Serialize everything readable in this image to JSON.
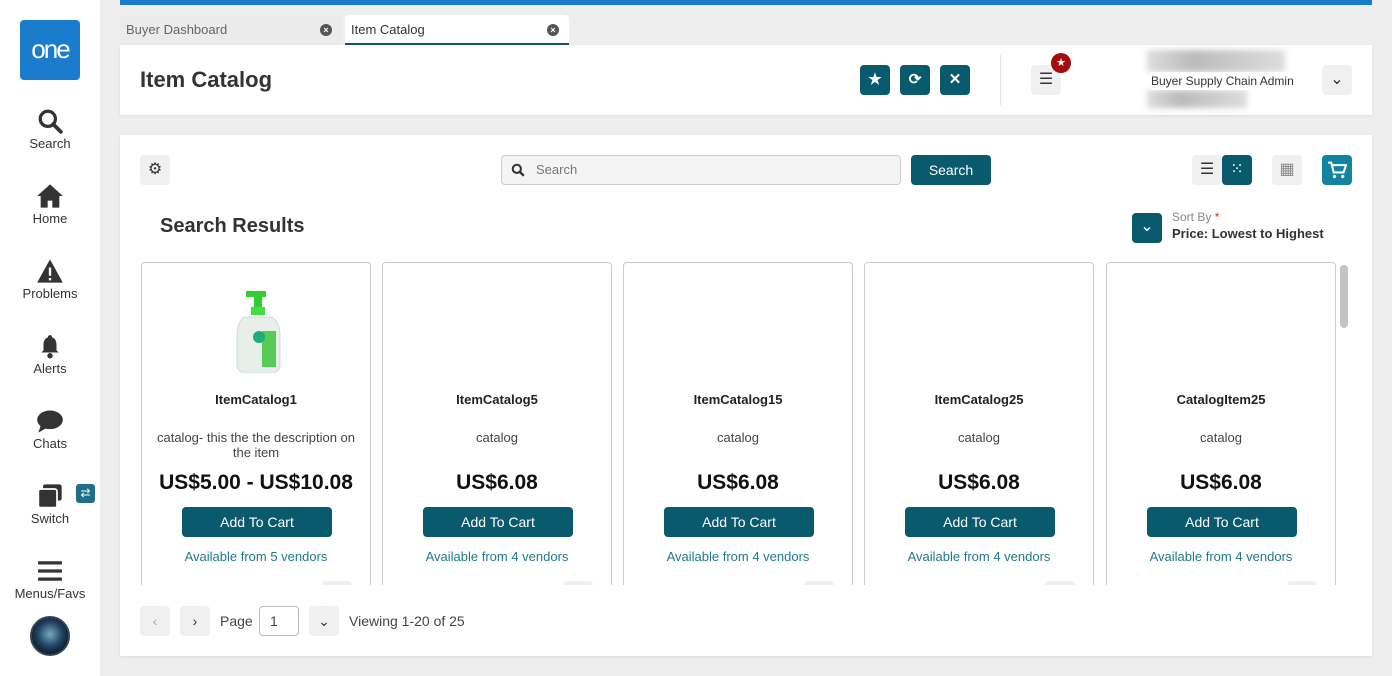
{
  "sidebar": {
    "logo": "one",
    "items": [
      {
        "label": "Search",
        "icon": "search-icon"
      },
      {
        "label": "Home",
        "icon": "home-icon"
      },
      {
        "label": "Problems",
        "icon": "warning-icon"
      },
      {
        "label": "Alerts",
        "icon": "bell-icon"
      },
      {
        "label": "Chats",
        "icon": "chat-icon"
      },
      {
        "label": "Switch",
        "icon": "switch-icon"
      },
      {
        "label": "Menus/Favs",
        "icon": "menu-icon"
      }
    ]
  },
  "tabs": [
    {
      "label": "Buyer Dashboard",
      "active": false
    },
    {
      "label": "Item Catalog",
      "active": true
    }
  ],
  "header": {
    "title": "Item Catalog",
    "role": "Buyer Supply Chain Admin"
  },
  "toolbar": {
    "search_placeholder": "Search",
    "search_button": "Search"
  },
  "results": {
    "title": "Search Results",
    "sort_label": "Sort By",
    "sort_required": "*",
    "sort_value": "Price: Lowest to Highest"
  },
  "items": [
    {
      "name": "ItemCatalog1",
      "desc": "catalog- this the the description on the item",
      "price": "US$5.00 - US$10.08",
      "button": "Add To Cart",
      "vendors": "Available from 5 vendors"
    },
    {
      "name": "ItemCatalog5",
      "desc": "catalog",
      "price": "US$6.08",
      "button": "Add To Cart",
      "vendors": "Available from 4 vendors"
    },
    {
      "name": "ItemCatalog15",
      "desc": "catalog",
      "price": "US$6.08",
      "button": "Add To Cart",
      "vendors": "Available from 4 vendors"
    },
    {
      "name": "ItemCatalog25",
      "desc": "catalog",
      "price": "US$6.08",
      "button": "Add To Cart",
      "vendors": "Available from 4 vendors"
    },
    {
      "name": "CatalogItem25",
      "desc": "catalog",
      "price": "US$6.08",
      "button": "Add To Cart",
      "vendors": "Available from 4 vendors"
    }
  ],
  "pagination": {
    "page_label": "Page",
    "page": "1",
    "viewing": "Viewing 1-20 of 25"
  },
  "colors": {
    "primary": "#0a5a6e",
    "brand": "#1a7ccc",
    "cart": "#12849f"
  }
}
